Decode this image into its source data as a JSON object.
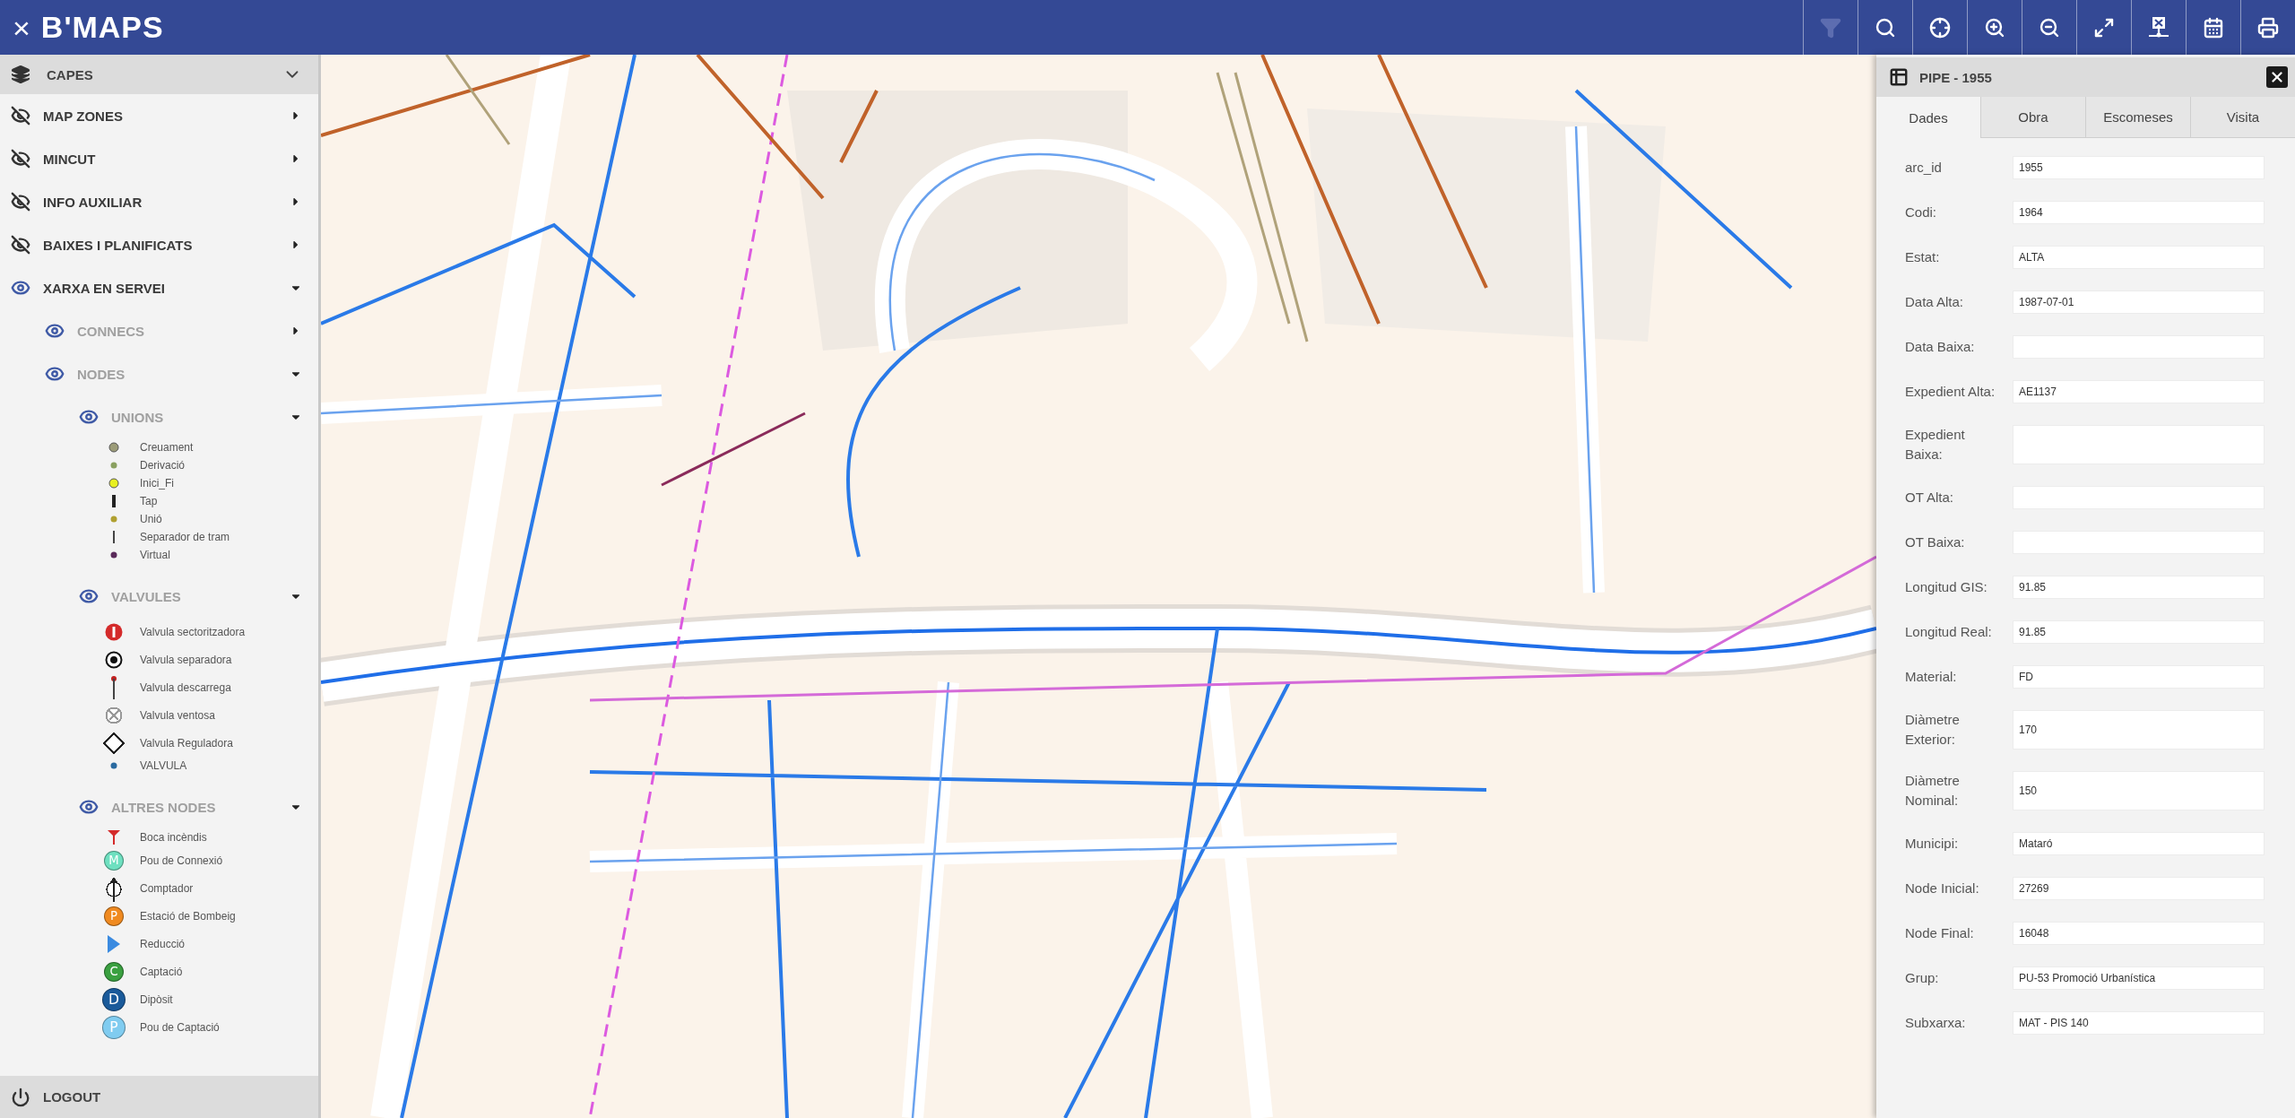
{
  "app_bar": {
    "close": "×",
    "logo": "B'MAPS"
  },
  "toolbar": [
    {
      "kind": "filter",
      "disabled": true
    },
    {
      "kind": "search",
      "disabled": false
    },
    {
      "kind": "locate",
      "disabled": false
    },
    {
      "kind": "zoom-in",
      "disabled": false
    },
    {
      "kind": "zoom-out",
      "disabled": false
    },
    {
      "kind": "expand",
      "disabled": false
    },
    {
      "kind": "network",
      "disabled": false
    },
    {
      "kind": "calendar",
      "disabled": false
    },
    {
      "kind": "print",
      "disabled": false
    }
  ],
  "layers": {
    "title": "CAPES",
    "expanded": true,
    "items": [
      {
        "label": "MAP ZONES",
        "visible": false,
        "expanded": false
      },
      {
        "label": "MINCUT",
        "visible": false,
        "expanded": false
      },
      {
        "label": "INFO AUXILIAR",
        "visible": false,
        "expanded": false
      },
      {
        "label": "BAIXES I PLANIFICATS",
        "visible": false,
        "expanded": false
      },
      {
        "label": "XARXA EN SERVEI",
        "visible": true,
        "expanded": true,
        "children": [
          {
            "label": "CONNECS",
            "visible": true,
            "expanded": false
          },
          {
            "label": "NODES",
            "visible": true,
            "expanded": true,
            "children": [
              {
                "label": "UNIONS",
                "visible": true,
                "expanded": true,
                "legend": [
                  {
                    "label": "Creuament",
                    "kind": "dot",
                    "color": "#9c9c78"
                  },
                  {
                    "label": "Derivació",
                    "kind": "small-dot",
                    "color": "#8aa060"
                  },
                  {
                    "label": "Inici_Fi",
                    "kind": "dot",
                    "color": "#e8f020"
                  },
                  {
                    "label": "Tap",
                    "kind": "bar",
                    "color": "#222222"
                  },
                  {
                    "label": "Unió",
                    "kind": "small-dot",
                    "color": "#b0a030"
                  },
                  {
                    "label": "Separador de tram",
                    "kind": "line",
                    "color": "#444444"
                  },
                  {
                    "label": "Virtual",
                    "kind": "small-dot",
                    "color": "#5a2a5a"
                  }
                ]
              },
              {
                "label": "VALVULES",
                "visible": true,
                "expanded": true,
                "legend": [
                  {
                    "label": "Valvula sectoritzadora",
                    "kind": "closed-valve",
                    "color": "#d42a2a"
                  },
                  {
                    "label": "Valvula separadora",
                    "kind": "ring-dot",
                    "color": "#111111"
                  },
                  {
                    "label": "Valvula descarrega",
                    "kind": "stem",
                    "color": "#444444"
                  },
                  {
                    "label": "Valvula ventosa",
                    "kind": "cross-circle",
                    "color": "#999999"
                  },
                  {
                    "label": "Valvula Reguladora",
                    "kind": "diamond",
                    "color": "#222222"
                  },
                  {
                    "label": "VALVULA",
                    "kind": "small-dot",
                    "color": "#2a6aa0"
                  }
                ]
              },
              {
                "label": "ALTRES NODES",
                "visible": true,
                "expanded": true,
                "legend": [
                  {
                    "label": "Boca incèndis",
                    "kind": "hydrant",
                    "color": "#d42a2a"
                  },
                  {
                    "label": "Pou de Connexió",
                    "kind": "letter",
                    "color": "#6ee0c0",
                    "glyph": "M"
                  },
                  {
                    "label": "Comptador",
                    "kind": "meter",
                    "color": "#222222"
                  },
                  {
                    "label": "Estació de Bombeig",
                    "kind": "letter",
                    "color": "#f08a20",
                    "glyph": "P"
                  },
                  {
                    "label": "Reducció",
                    "kind": "triangle",
                    "color": "#3a8ae0"
                  },
                  {
                    "label": "Captació",
                    "kind": "letter",
                    "color": "#3aa040",
                    "glyph": "C"
                  },
                  {
                    "label": "Dipòsit",
                    "kind": "big-letter",
                    "color": "#1a5a9a",
                    "glyph": "D"
                  },
                  {
                    "label": "Pou de Captació",
                    "kind": "big-letter",
                    "color": "#80ccf0",
                    "glyph": "P"
                  }
                ]
              }
            ]
          }
        ]
      }
    ]
  },
  "logout": {
    "label": "LOGOUT"
  },
  "info_panel": {
    "title": "PIPE - 1955",
    "tabs": [
      {
        "label": "Dades",
        "selected": true
      },
      {
        "label": "Obra",
        "selected": false
      },
      {
        "label": "Escomeses",
        "selected": false
      },
      {
        "label": "Visita",
        "selected": false
      }
    ],
    "fields": [
      {
        "label": "arc_id",
        "value": "1955"
      },
      {
        "label": "Codi:",
        "value": "1964"
      },
      {
        "label": "Estat:",
        "value": "ALTA"
      },
      {
        "label": "Data Alta:",
        "value": "1987-07-01"
      },
      {
        "label": "Data Baixa:"
      },
      {
        "label": "Expedient Alta:",
        "value": "AE1137"
      },
      {
        "label": "Expedient Baixa:"
      },
      {
        "label": "OT Alta:"
      },
      {
        "label": "OT Baixa:"
      },
      {
        "label": "Longitud GIS:",
        "value": "91.85"
      },
      {
        "label": "Longitud Real:",
        "value": "91.85"
      },
      {
        "label": "Material:",
        "value": "FD"
      },
      {
        "label": "Diàmetre Exterior:",
        "value": "170"
      },
      {
        "label": "Diàmetre Nominal:",
        "value": "150"
      },
      {
        "label": "Municipi:",
        "value": "Mataró"
      },
      {
        "label": "Node Inicial:",
        "value": "27269"
      },
      {
        "label": "Node Final:",
        "value": "16048"
      },
      {
        "label": "Grup:",
        "value": "PU-53 Promoció Urbanística"
      },
      {
        "label": "Subxarxa:",
        "value": "MAT - PIS 140"
      }
    ]
  }
}
